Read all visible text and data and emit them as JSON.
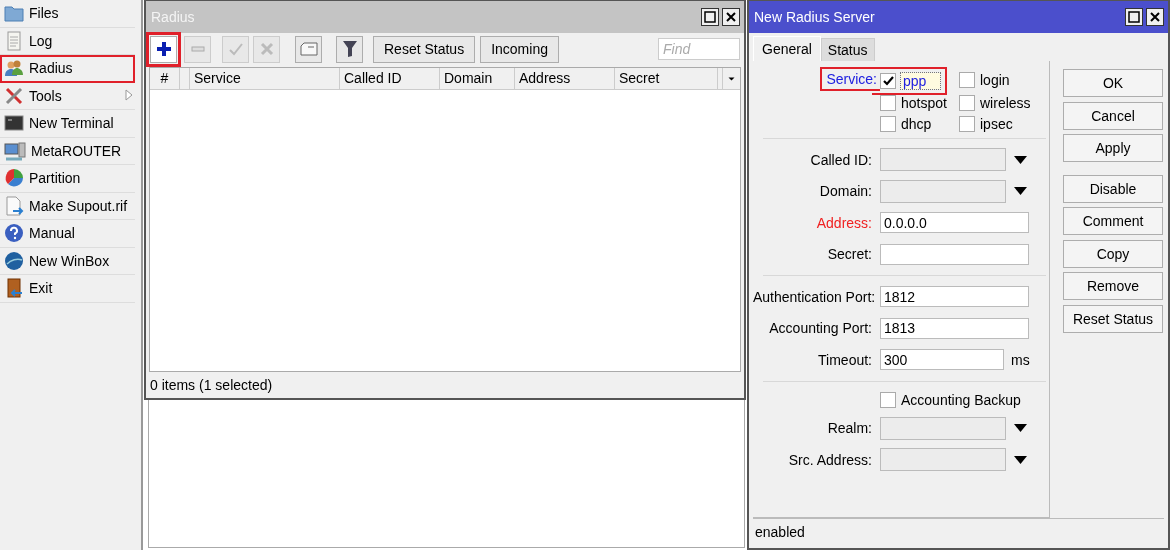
{
  "sidebar": {
    "items": [
      {
        "label": "Files",
        "highlighted": false,
        "has_submenu": false
      },
      {
        "label": "Log",
        "highlighted": false,
        "has_submenu": false
      },
      {
        "label": "Radius",
        "highlighted": true,
        "has_submenu": false
      },
      {
        "label": "Tools",
        "highlighted": false,
        "has_submenu": true
      },
      {
        "label": "New Terminal",
        "highlighted": false,
        "has_submenu": false
      },
      {
        "label": "MetaROUTER",
        "highlighted": false,
        "has_submenu": false
      },
      {
        "label": "Partition",
        "highlighted": false,
        "has_submenu": false
      },
      {
        "label": "Make Supout.rif",
        "highlighted": false,
        "has_submenu": false
      },
      {
        "label": "Manual",
        "highlighted": false,
        "has_submenu": false
      },
      {
        "label": "New WinBox",
        "highlighted": false,
        "has_submenu": false
      },
      {
        "label": "Exit",
        "highlighted": false,
        "has_submenu": false
      }
    ]
  },
  "radius_window": {
    "title": "Radius",
    "icon_buttons": [
      {
        "disabled": false,
        "highlighted": true
      },
      {
        "disabled": true,
        "highlighted": false
      },
      {
        "disabled": true,
        "highlighted": false
      },
      {
        "disabled": true,
        "highlighted": false
      },
      {
        "disabled": false,
        "highlighted": false
      },
      {
        "disabled": false,
        "highlighted": false
      }
    ],
    "text_buttons": [
      "Reset Status",
      "Incoming"
    ],
    "search": {
      "placeholder": "Find"
    },
    "columns": [
      "#",
      "Service",
      "Called ID",
      "Domain",
      "Address",
      "Secret"
    ],
    "status_bar": "0 items (1 selected)"
  },
  "dialog": {
    "title": "New Radius Server",
    "tabs": [
      {
        "label": "General",
        "selected": true
      },
      {
        "label": "Status",
        "selected": false
      }
    ],
    "service": {
      "label": "Service:",
      "highlighted": true,
      "options": [
        {
          "label": "ppp",
          "checked": true,
          "focused": true
        },
        {
          "label": "login",
          "checked": false,
          "focused": false
        },
        {
          "label": "hotspot",
          "checked": false,
          "focused": false
        },
        {
          "label": "wireless",
          "checked": false,
          "focused": false
        },
        {
          "label": "dhcp",
          "checked": false,
          "focused": false
        },
        {
          "label": "ipsec",
          "checked": false,
          "focused": false
        }
      ]
    },
    "fields": [
      {
        "kind": "separator"
      },
      {
        "kind": "dropdown",
        "label": "Called ID:",
        "invalid": false
      },
      {
        "kind": "dropdown",
        "label": "Domain:",
        "invalid": false
      },
      {
        "kind": "text",
        "label": "Address:",
        "value": "0.0.0.0",
        "invalid": true
      },
      {
        "kind": "text",
        "label": "Secret:",
        "invalid": false
      },
      {
        "kind": "separator"
      },
      {
        "kind": "text",
        "label": "Authentication Port:",
        "value": "1812",
        "invalid": false
      },
      {
        "kind": "text",
        "label": "Accounting Port:",
        "value": "1813",
        "invalid": false
      },
      {
        "kind": "text",
        "label": "Timeout:",
        "value": "300",
        "unit": "ms",
        "invalid": false
      },
      {
        "kind": "separator"
      },
      {
        "kind": "checkbox",
        "label": "Accounting Backup",
        "checked": false
      },
      {
        "kind": "dropdown",
        "label": "Realm:",
        "invalid": false
      },
      {
        "kind": "dropdown",
        "label": "Src. Address:",
        "invalid": false
      }
    ],
    "buttons": [
      "OK",
      "Cancel",
      "Apply",
      "Disable",
      "Comment",
      "Copy",
      "Remove",
      "Reset Status"
    ],
    "status_bar": "enabled"
  }
}
